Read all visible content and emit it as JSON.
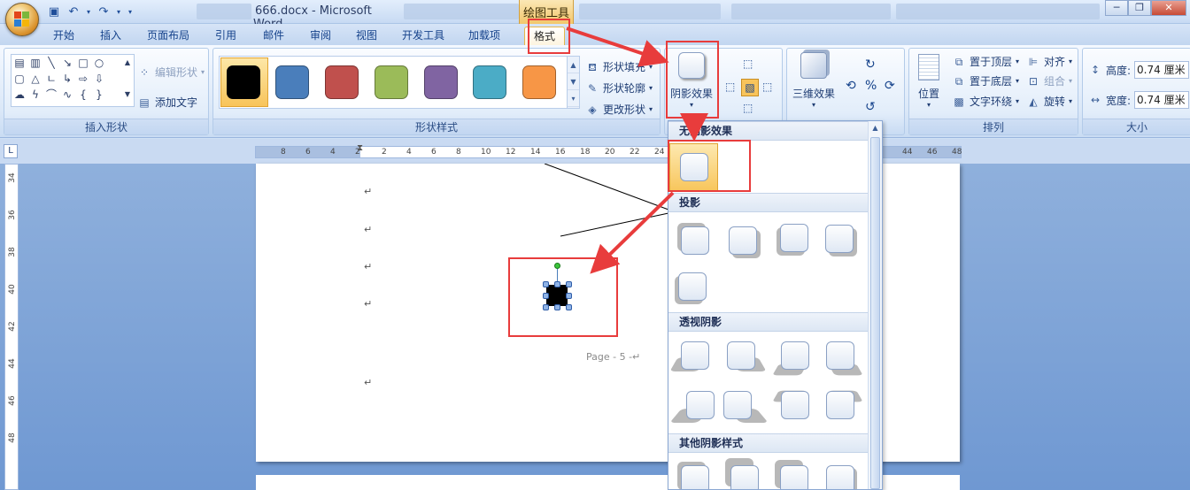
{
  "window": {
    "doc_name": "666.docx",
    "separator": "-",
    "app_name": "Microsoft Word",
    "context_tool": "绘图工具"
  },
  "tabs": [
    {
      "label": "开始"
    },
    {
      "label": "插入"
    },
    {
      "label": "页面布局"
    },
    {
      "label": "引用"
    },
    {
      "label": "邮件"
    },
    {
      "label": "审阅"
    },
    {
      "label": "视图"
    },
    {
      "label": "开发工具"
    },
    {
      "label": "加载项"
    },
    {
      "label": "格式"
    }
  ],
  "ribbon": {
    "insert_shapes": {
      "label": "插入形状",
      "edit_shape": "编辑形状",
      "add_text": "添加文字"
    },
    "shape_styles": {
      "label": "形状样式",
      "swatches": [
        "#000000",
        "#4a7ebb",
        "#c0504d",
        "#9bbb59",
        "#8064a2",
        "#4bacc6",
        "#f79646"
      ],
      "fill": "形状填充",
      "outline": "形状轮廓",
      "change": "更改形状"
    },
    "shadow": {
      "label": "阴影效果"
    },
    "three_d": {
      "label": "三维效果"
    },
    "arrange": {
      "label": "排列",
      "position": "位置",
      "bring_front": "置于顶层",
      "send_back": "置于底层",
      "wrap": "文字环绕",
      "align": "对齐",
      "group": "组合",
      "rotate": "旋转"
    },
    "size": {
      "label": "大小",
      "height_label": "高度:",
      "height_value": "0.74 厘米",
      "width_label": "宽度:",
      "width_value": "0.74 厘米"
    }
  },
  "ruler": {
    "ticks": [
      "8",
      "6",
      "4",
      "2",
      "2",
      "4",
      "6",
      "8",
      "10",
      "12",
      "14",
      "16",
      "18",
      "20",
      "22",
      "24",
      "44",
      "46",
      "48"
    ],
    "vticks": [
      "34",
      "36",
      "38",
      "40",
      "42",
      "44",
      "46",
      "48"
    ]
  },
  "document": {
    "para_mark": "↵",
    "page_label": "Page - 5 -↵"
  },
  "dropdown": {
    "no_shadow": "无阴影效果",
    "drop_shadow": "投影",
    "perspective": "透视阴影",
    "other": "其他阴影样式"
  },
  "colors": {
    "accent_red": "#e83c3c",
    "ribbon_blue": "#15428b",
    "highlight": "#f8c45b"
  }
}
